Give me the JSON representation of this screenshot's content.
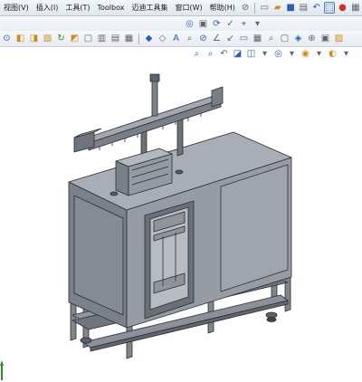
{
  "menubar": {
    "items": [
      "视图(V)",
      "插入(I)",
      "工具(T)",
      "Toolbox",
      "迈迪工具集",
      "窗口(W)",
      "帮助(H)"
    ]
  },
  "toolbar_icons": {
    "row1": [
      "pin-icon",
      "new-document-icon",
      "open-folder-icon",
      "save-icon",
      "print-icon",
      "undo-icon",
      "select-icon",
      "traffic-light-icon",
      "options-icon"
    ],
    "row2": [
      "snap-icon",
      "cube-icon",
      "smart-dim-icon",
      "feature-icon",
      "refresh-icon",
      "assembly-icon",
      "sketch-icon",
      "note-icon"
    ],
    "row3": [
      "zoom-fit-icon",
      "zoom-area-icon",
      "previous-view-icon",
      "section-view-icon",
      "view-orient-icon",
      "display-style-icon",
      "hide-show-icon",
      "appearance-icon",
      "scene-icon",
      "view-settings-icon"
    ]
  },
  "colors": {
    "menubar_bg": "#e8edf3",
    "model_stroke": "#2b2e33",
    "model_fill": "#8c919b",
    "model_fill_dark": "#6e737c",
    "model_fill_light": "#a4a8b0",
    "accent_select": "#5b7fb3"
  }
}
